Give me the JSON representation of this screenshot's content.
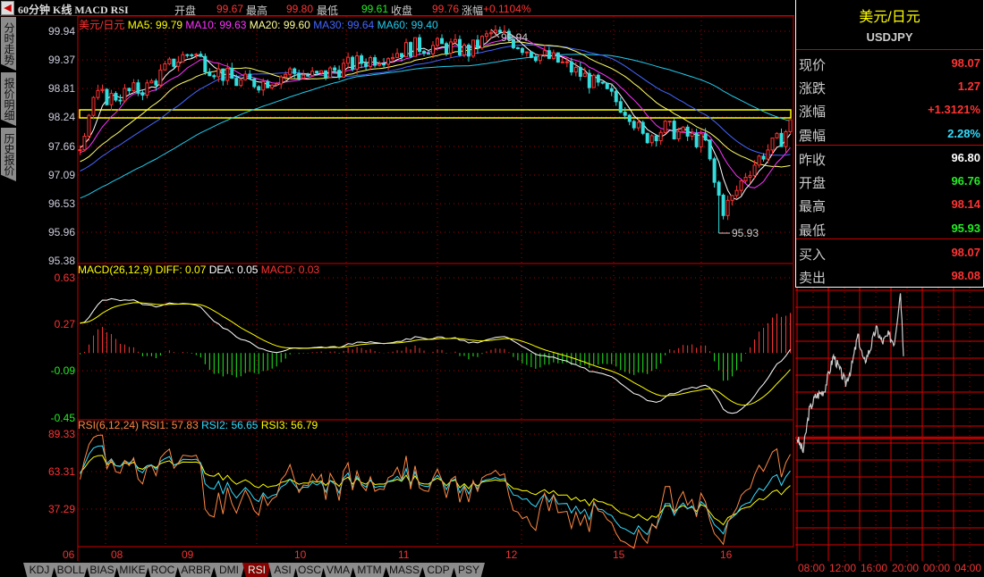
{
  "window": {
    "title": "60分钟 K线 MACD RSI"
  },
  "quote_bar": {
    "open_label": "开盘",
    "open": "99.67",
    "high_label": "最高",
    "high": "99.80",
    "low_label": "最低",
    "low": "99.61",
    "close_label": "收盘",
    "close": "99.76",
    "change_label": "涨幅",
    "change": "+0.1104%"
  },
  "side_tabs": [
    "分时走势",
    "报价明细",
    "历史报价"
  ],
  "price_pane": {
    "legend": {
      "symbol": "美元/日元",
      "ma5": "MA5: 99.79",
      "ma10": "MA10: 99.63",
      "ma20": "MA20: 99.60",
      "ma30": "MA30: 99.64",
      "ma60": "MA60: 99.40"
    },
    "y_ticks": [
      "99.94",
      "99.37",
      "98.81",
      "98.24",
      "97.66",
      "97.09",
      "96.53",
      "95.96",
      "95.38"
    ],
    "high_marker": "99.94",
    "low_marker": "95.93"
  },
  "macd_pane": {
    "legend": {
      "name": "MACD(26,12,9)",
      "diff": "DIFF: 0.07",
      "dea": "DEA: 0.05",
      "macd": "MACD: 0.03"
    },
    "y_ticks": [
      "0.63",
      "0.27",
      "-0.09",
      "-0.45"
    ]
  },
  "rsi_pane": {
    "legend": {
      "name": "RSI(6,12,24)",
      "rsi1": "RSI1: 57.83",
      "rsi2": "RSI2: 56.65",
      "rsi3": "RSI3: 56.79"
    },
    "y_ticks": [
      "89.33",
      "63.31",
      "37.29"
    ]
  },
  "x_labels": [
    "06",
    "08",
    "09",
    "10",
    "11",
    "12",
    "15",
    "16"
  ],
  "indicator_tabs": [
    "KDJ",
    "BOLL",
    "BIAS",
    "MIKE",
    "ROC",
    "ARBR",
    "DMI",
    "RSI",
    "ASI",
    "OSC",
    "VMA",
    "MTM",
    "MASS",
    "CDP",
    "PSY"
  ],
  "active_tab": "RSI",
  "right_panel": {
    "name": "美元/日元",
    "code": "USDJPY",
    "rows": [
      {
        "label": "现价",
        "value": "98.07",
        "color": "#ff3333"
      },
      {
        "label": "涨跌",
        "value": "1.27",
        "color": "#ff3333"
      },
      {
        "label": "涨幅",
        "value": "+1.3121%",
        "color": "#ff3333"
      },
      {
        "label": "震幅",
        "value": "2.28%",
        "color": "#33ddff"
      },
      {
        "label": "昨收",
        "value": "96.80",
        "color": "#ffffff"
      },
      {
        "label": "开盘",
        "value": "96.76",
        "color": "#22ee22"
      },
      {
        "label": "最高",
        "value": "98.14",
        "color": "#ff3333"
      },
      {
        "label": "最低",
        "value": "95.93",
        "color": "#22ee22"
      },
      {
        "label": "买入",
        "value": "98.07",
        "color": "#ff3333"
      },
      {
        "label": "卖出",
        "value": "98.08",
        "color": "#ff3333"
      }
    ],
    "time_labels": [
      "08:00",
      "12:00",
      "16:00",
      "20:00",
      "00:00",
      "04:00"
    ]
  },
  "chart_data": {
    "type": "candlestick",
    "bars": 160,
    "price_anchors": [
      [
        -80,
        95.2
      ],
      [
        -40,
        96.2
      ],
      [
        -10,
        97.3
      ],
      [
        0,
        97.7
      ],
      [
        3,
        98.6
      ],
      [
        7,
        98.6
      ],
      [
        11,
        98.7
      ],
      [
        15,
        98.8
      ],
      [
        21,
        99.3
      ],
      [
        25,
        99.5
      ],
      [
        29,
        99.2
      ],
      [
        35,
        98.9
      ],
      [
        41,
        98.9
      ],
      [
        47,
        99.1
      ],
      [
        53,
        99.0
      ],
      [
        59,
        99.2
      ],
      [
        67,
        99.4
      ],
      [
        75,
        99.6
      ],
      [
        83,
        99.6
      ],
      [
        87,
        99.5
      ],
      [
        92,
        99.85
      ],
      [
        95,
        99.8
      ],
      [
        101,
        99.5
      ],
      [
        107,
        99.3
      ],
      [
        113,
        99.0
      ],
      [
        119,
        98.6
      ],
      [
        123,
        98.3
      ],
      [
        126,
        97.8
      ],
      [
        131,
        98.0
      ],
      [
        137,
        97.8
      ],
      [
        140,
        97.7
      ],
      [
        142,
        96.9
      ],
      [
        144,
        96.4
      ],
      [
        146,
        96.6
      ],
      [
        149,
        97.1
      ],
      [
        153,
        97.5
      ],
      [
        157,
        97.8
      ],
      [
        159,
        98.07
      ]
    ],
    "price_range": [
      95.33,
      100.2
    ],
    "macd_range": [
      -0.55,
      0.73
    ],
    "rsi_range": [
      11,
      100
    ],
    "intraday_anchors": [
      [
        0,
        96.8
      ],
      [
        4,
        96.6
      ],
      [
        8,
        97.2
      ],
      [
        12,
        97.4
      ],
      [
        18,
        97.5
      ],
      [
        24,
        98.0
      ],
      [
        28,
        97.8
      ],
      [
        32,
        97.6
      ],
      [
        36,
        97.85
      ],
      [
        40,
        98.3
      ],
      [
        44,
        97.9
      ],
      [
        48,
        98.1
      ],
      [
        52,
        98.4
      ],
      [
        56,
        98.2
      ],
      [
        60,
        98.3
      ],
      [
        64,
        98.2
      ],
      [
        68,
        98.95
      ],
      [
        70,
        98.07
      ]
    ],
    "intraday_range": [
      95.0,
      99.0
    ],
    "prev_close": 96.8,
    "colors": {
      "up": "#ff3333",
      "down": "#33dddd",
      "ma5": "#ffffff",
      "ma10": "#ff33ff",
      "ma20": "#ffff66",
      "ma30": "#4466ff",
      "ma60": "#22ccee",
      "diff": "#ffffff",
      "dea": "#ffff00",
      "rsi1": "#ff8844",
      "rsi2": "#33ddff",
      "rsi3": "#ffff00"
    }
  }
}
